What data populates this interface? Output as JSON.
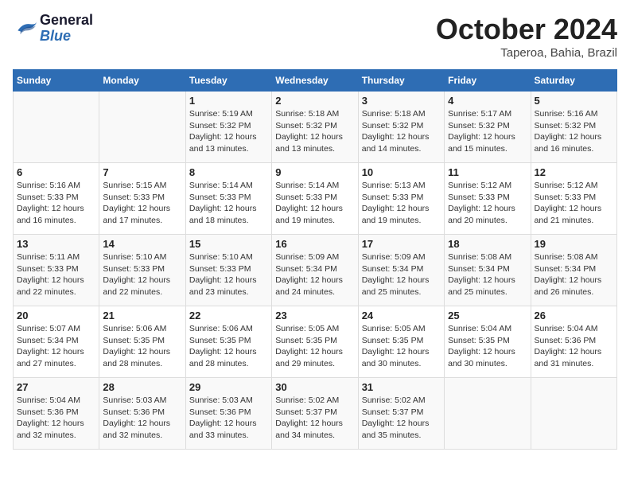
{
  "header": {
    "logo_line1": "General",
    "logo_line2": "Blue",
    "month": "October 2024",
    "location": "Taperoa, Bahia, Brazil"
  },
  "days_of_week": [
    "Sunday",
    "Monday",
    "Tuesday",
    "Wednesday",
    "Thursday",
    "Friday",
    "Saturday"
  ],
  "weeks": [
    [
      {
        "day": "",
        "info": ""
      },
      {
        "day": "",
        "info": ""
      },
      {
        "day": "1",
        "info": "Sunrise: 5:19 AM\nSunset: 5:32 PM\nDaylight: 12 hours\nand 13 minutes."
      },
      {
        "day": "2",
        "info": "Sunrise: 5:18 AM\nSunset: 5:32 PM\nDaylight: 12 hours\nand 13 minutes."
      },
      {
        "day": "3",
        "info": "Sunrise: 5:18 AM\nSunset: 5:32 PM\nDaylight: 12 hours\nand 14 minutes."
      },
      {
        "day": "4",
        "info": "Sunrise: 5:17 AM\nSunset: 5:32 PM\nDaylight: 12 hours\nand 15 minutes."
      },
      {
        "day": "5",
        "info": "Sunrise: 5:16 AM\nSunset: 5:32 PM\nDaylight: 12 hours\nand 16 minutes."
      }
    ],
    [
      {
        "day": "6",
        "info": "Sunrise: 5:16 AM\nSunset: 5:33 PM\nDaylight: 12 hours\nand 16 minutes."
      },
      {
        "day": "7",
        "info": "Sunrise: 5:15 AM\nSunset: 5:33 PM\nDaylight: 12 hours\nand 17 minutes."
      },
      {
        "day": "8",
        "info": "Sunrise: 5:14 AM\nSunset: 5:33 PM\nDaylight: 12 hours\nand 18 minutes."
      },
      {
        "day": "9",
        "info": "Sunrise: 5:14 AM\nSunset: 5:33 PM\nDaylight: 12 hours\nand 19 minutes."
      },
      {
        "day": "10",
        "info": "Sunrise: 5:13 AM\nSunset: 5:33 PM\nDaylight: 12 hours\nand 19 minutes."
      },
      {
        "day": "11",
        "info": "Sunrise: 5:12 AM\nSunset: 5:33 PM\nDaylight: 12 hours\nand 20 minutes."
      },
      {
        "day": "12",
        "info": "Sunrise: 5:12 AM\nSunset: 5:33 PM\nDaylight: 12 hours\nand 21 minutes."
      }
    ],
    [
      {
        "day": "13",
        "info": "Sunrise: 5:11 AM\nSunset: 5:33 PM\nDaylight: 12 hours\nand 22 minutes."
      },
      {
        "day": "14",
        "info": "Sunrise: 5:10 AM\nSunset: 5:33 PM\nDaylight: 12 hours\nand 22 minutes."
      },
      {
        "day": "15",
        "info": "Sunrise: 5:10 AM\nSunset: 5:33 PM\nDaylight: 12 hours\nand 23 minutes."
      },
      {
        "day": "16",
        "info": "Sunrise: 5:09 AM\nSunset: 5:34 PM\nDaylight: 12 hours\nand 24 minutes."
      },
      {
        "day": "17",
        "info": "Sunrise: 5:09 AM\nSunset: 5:34 PM\nDaylight: 12 hours\nand 25 minutes."
      },
      {
        "day": "18",
        "info": "Sunrise: 5:08 AM\nSunset: 5:34 PM\nDaylight: 12 hours\nand 25 minutes."
      },
      {
        "day": "19",
        "info": "Sunrise: 5:08 AM\nSunset: 5:34 PM\nDaylight: 12 hours\nand 26 minutes."
      }
    ],
    [
      {
        "day": "20",
        "info": "Sunrise: 5:07 AM\nSunset: 5:34 PM\nDaylight: 12 hours\nand 27 minutes."
      },
      {
        "day": "21",
        "info": "Sunrise: 5:06 AM\nSunset: 5:35 PM\nDaylight: 12 hours\nand 28 minutes."
      },
      {
        "day": "22",
        "info": "Sunrise: 5:06 AM\nSunset: 5:35 PM\nDaylight: 12 hours\nand 28 minutes."
      },
      {
        "day": "23",
        "info": "Sunrise: 5:05 AM\nSunset: 5:35 PM\nDaylight: 12 hours\nand 29 minutes."
      },
      {
        "day": "24",
        "info": "Sunrise: 5:05 AM\nSunset: 5:35 PM\nDaylight: 12 hours\nand 30 minutes."
      },
      {
        "day": "25",
        "info": "Sunrise: 5:04 AM\nSunset: 5:35 PM\nDaylight: 12 hours\nand 30 minutes."
      },
      {
        "day": "26",
        "info": "Sunrise: 5:04 AM\nSunset: 5:36 PM\nDaylight: 12 hours\nand 31 minutes."
      }
    ],
    [
      {
        "day": "27",
        "info": "Sunrise: 5:04 AM\nSunset: 5:36 PM\nDaylight: 12 hours\nand 32 minutes."
      },
      {
        "day": "28",
        "info": "Sunrise: 5:03 AM\nSunset: 5:36 PM\nDaylight: 12 hours\nand 32 minutes."
      },
      {
        "day": "29",
        "info": "Sunrise: 5:03 AM\nSunset: 5:36 PM\nDaylight: 12 hours\nand 33 minutes."
      },
      {
        "day": "30",
        "info": "Sunrise: 5:02 AM\nSunset: 5:37 PM\nDaylight: 12 hours\nand 34 minutes."
      },
      {
        "day": "31",
        "info": "Sunrise: 5:02 AM\nSunset: 5:37 PM\nDaylight: 12 hours\nand 35 minutes."
      },
      {
        "day": "",
        "info": ""
      },
      {
        "day": "",
        "info": ""
      }
    ]
  ]
}
